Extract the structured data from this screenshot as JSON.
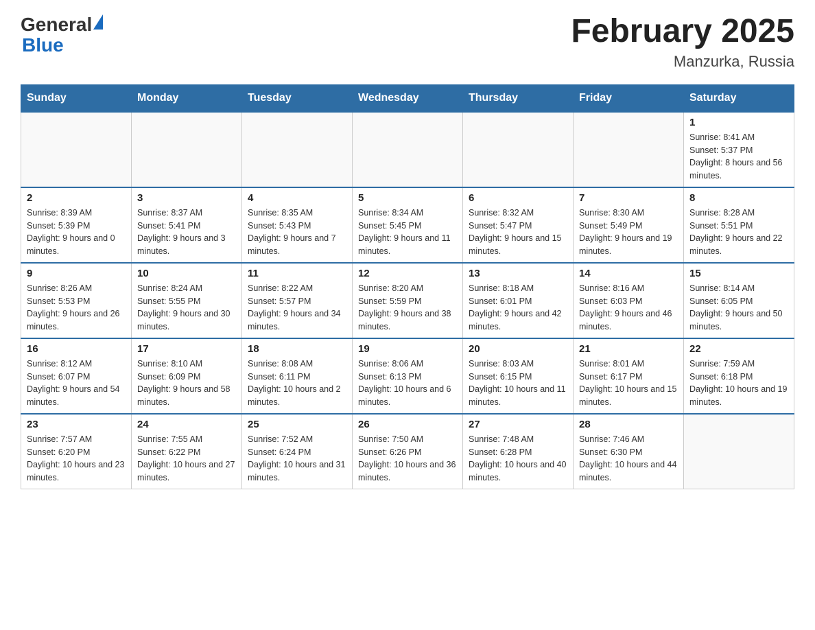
{
  "header": {
    "logo_general": "General",
    "logo_blue": "Blue",
    "month_title": "February 2025",
    "location": "Manzurka, Russia"
  },
  "weekdays": [
    "Sunday",
    "Monday",
    "Tuesday",
    "Wednesday",
    "Thursday",
    "Friday",
    "Saturday"
  ],
  "weeks": [
    [
      {
        "day": "",
        "info": ""
      },
      {
        "day": "",
        "info": ""
      },
      {
        "day": "",
        "info": ""
      },
      {
        "day": "",
        "info": ""
      },
      {
        "day": "",
        "info": ""
      },
      {
        "day": "",
        "info": ""
      },
      {
        "day": "1",
        "info": "Sunrise: 8:41 AM\nSunset: 5:37 PM\nDaylight: 8 hours and 56 minutes."
      }
    ],
    [
      {
        "day": "2",
        "info": "Sunrise: 8:39 AM\nSunset: 5:39 PM\nDaylight: 9 hours and 0 minutes."
      },
      {
        "day": "3",
        "info": "Sunrise: 8:37 AM\nSunset: 5:41 PM\nDaylight: 9 hours and 3 minutes."
      },
      {
        "day": "4",
        "info": "Sunrise: 8:35 AM\nSunset: 5:43 PM\nDaylight: 9 hours and 7 minutes."
      },
      {
        "day": "5",
        "info": "Sunrise: 8:34 AM\nSunset: 5:45 PM\nDaylight: 9 hours and 11 minutes."
      },
      {
        "day": "6",
        "info": "Sunrise: 8:32 AM\nSunset: 5:47 PM\nDaylight: 9 hours and 15 minutes."
      },
      {
        "day": "7",
        "info": "Sunrise: 8:30 AM\nSunset: 5:49 PM\nDaylight: 9 hours and 19 minutes."
      },
      {
        "day": "8",
        "info": "Sunrise: 8:28 AM\nSunset: 5:51 PM\nDaylight: 9 hours and 22 minutes."
      }
    ],
    [
      {
        "day": "9",
        "info": "Sunrise: 8:26 AM\nSunset: 5:53 PM\nDaylight: 9 hours and 26 minutes."
      },
      {
        "day": "10",
        "info": "Sunrise: 8:24 AM\nSunset: 5:55 PM\nDaylight: 9 hours and 30 minutes."
      },
      {
        "day": "11",
        "info": "Sunrise: 8:22 AM\nSunset: 5:57 PM\nDaylight: 9 hours and 34 minutes."
      },
      {
        "day": "12",
        "info": "Sunrise: 8:20 AM\nSunset: 5:59 PM\nDaylight: 9 hours and 38 minutes."
      },
      {
        "day": "13",
        "info": "Sunrise: 8:18 AM\nSunset: 6:01 PM\nDaylight: 9 hours and 42 minutes."
      },
      {
        "day": "14",
        "info": "Sunrise: 8:16 AM\nSunset: 6:03 PM\nDaylight: 9 hours and 46 minutes."
      },
      {
        "day": "15",
        "info": "Sunrise: 8:14 AM\nSunset: 6:05 PM\nDaylight: 9 hours and 50 minutes."
      }
    ],
    [
      {
        "day": "16",
        "info": "Sunrise: 8:12 AM\nSunset: 6:07 PM\nDaylight: 9 hours and 54 minutes."
      },
      {
        "day": "17",
        "info": "Sunrise: 8:10 AM\nSunset: 6:09 PM\nDaylight: 9 hours and 58 minutes."
      },
      {
        "day": "18",
        "info": "Sunrise: 8:08 AM\nSunset: 6:11 PM\nDaylight: 10 hours and 2 minutes."
      },
      {
        "day": "19",
        "info": "Sunrise: 8:06 AM\nSunset: 6:13 PM\nDaylight: 10 hours and 6 minutes."
      },
      {
        "day": "20",
        "info": "Sunrise: 8:03 AM\nSunset: 6:15 PM\nDaylight: 10 hours and 11 minutes."
      },
      {
        "day": "21",
        "info": "Sunrise: 8:01 AM\nSunset: 6:17 PM\nDaylight: 10 hours and 15 minutes."
      },
      {
        "day": "22",
        "info": "Sunrise: 7:59 AM\nSunset: 6:18 PM\nDaylight: 10 hours and 19 minutes."
      }
    ],
    [
      {
        "day": "23",
        "info": "Sunrise: 7:57 AM\nSunset: 6:20 PM\nDaylight: 10 hours and 23 minutes."
      },
      {
        "day": "24",
        "info": "Sunrise: 7:55 AM\nSunset: 6:22 PM\nDaylight: 10 hours and 27 minutes."
      },
      {
        "day": "25",
        "info": "Sunrise: 7:52 AM\nSunset: 6:24 PM\nDaylight: 10 hours and 31 minutes."
      },
      {
        "day": "26",
        "info": "Sunrise: 7:50 AM\nSunset: 6:26 PM\nDaylight: 10 hours and 36 minutes."
      },
      {
        "day": "27",
        "info": "Sunrise: 7:48 AM\nSunset: 6:28 PM\nDaylight: 10 hours and 40 minutes."
      },
      {
        "day": "28",
        "info": "Sunrise: 7:46 AM\nSunset: 6:30 PM\nDaylight: 10 hours and 44 minutes."
      },
      {
        "day": "",
        "info": ""
      }
    ]
  ]
}
